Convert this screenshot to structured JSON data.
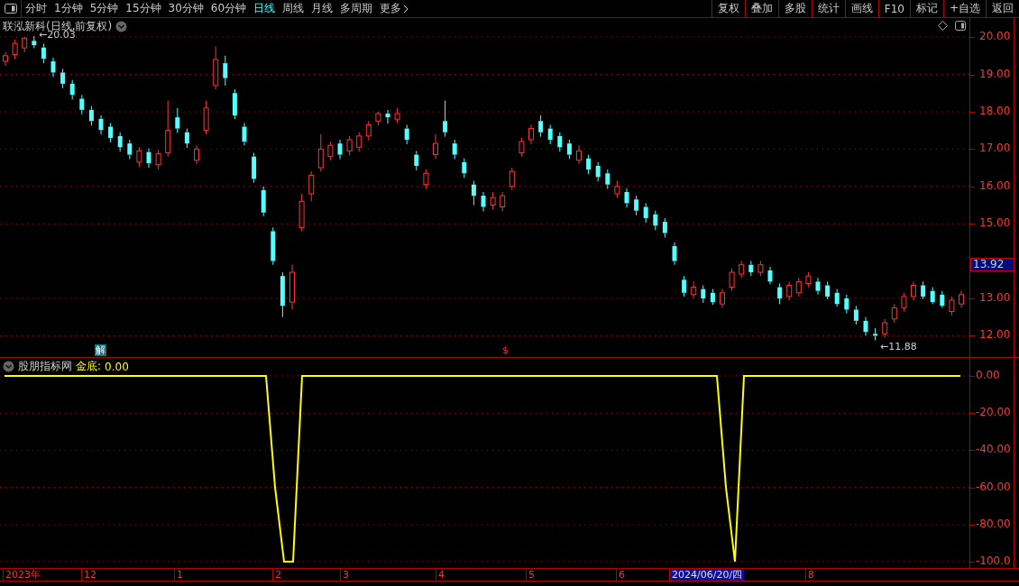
{
  "toolbar": {
    "periods": [
      {
        "label": "分时",
        "selected": false
      },
      {
        "label": "1分钟",
        "selected": false
      },
      {
        "label": "5分钟",
        "selected": false
      },
      {
        "label": "15分钟",
        "selected": false
      },
      {
        "label": "30分钟",
        "selected": false
      },
      {
        "label": "60分钟",
        "selected": false
      },
      {
        "label": "日线",
        "selected": true
      },
      {
        "label": "周线",
        "selected": false
      },
      {
        "label": "月线",
        "selected": false
      },
      {
        "label": "多周期",
        "selected": false
      }
    ],
    "more": "更多",
    "buttons": [
      "复权",
      "叠加",
      "多股",
      "统计",
      "画线",
      "F10",
      "标记",
      "+自选",
      "返回"
    ]
  },
  "chart": {
    "title": "联泓新科(日线,前复权)",
    "high_label": "←20.03",
    "low_label": "←11.88",
    "current_price": "13.92",
    "markers": [
      {
        "kind": "jie",
        "text": "解"
      },
      {
        "kind": "dollar",
        "text": "$"
      }
    ],
    "chart_data": {
      "type": "candlestick",
      "ylim": [
        11.43,
        20.51
      ],
      "grid": true,
      "yticks": [
        {
          "value": 20,
          "label": "20.00"
        },
        {
          "value": 19,
          "label": "19.00"
        },
        {
          "value": 18,
          "label": "18.00"
        },
        {
          "value": 17,
          "label": "17.00"
        },
        {
          "value": 16,
          "label": "16.00"
        },
        {
          "value": 15,
          "label": "15.00"
        },
        {
          "value": 13,
          "label": "13.00"
        },
        {
          "value": 12,
          "label": "12.00"
        }
      ],
      "ohlc": [
        [
          19.35,
          19.6,
          19.23,
          19.5
        ],
        [
          19.53,
          19.93,
          19.41,
          19.83
        ],
        [
          19.71,
          20.01,
          19.59,
          19.96
        ],
        [
          19.9,
          20.03,
          19.7,
          19.78
        ],
        [
          19.72,
          19.82,
          19.3,
          19.42
        ],
        [
          19.35,
          19.45,
          18.93,
          19.05
        ],
        [
          19.05,
          19.15,
          18.63,
          18.75
        ],
        [
          18.75,
          18.85,
          18.33,
          18.45
        ],
        [
          18.35,
          18.45,
          17.93,
          18.05
        ],
        [
          18.05,
          18.15,
          17.63,
          17.75
        ],
        [
          17.81,
          17.91,
          17.39,
          17.51
        ],
        [
          17.6,
          17.7,
          17.18,
          17.3
        ],
        [
          17.35,
          17.45,
          16.93,
          17.05
        ],
        [
          17.15,
          17.25,
          16.73,
          16.85
        ],
        [
          16.65,
          17.05,
          16.53,
          16.95
        ],
        [
          16.92,
          17.02,
          16.5,
          16.62
        ],
        [
          16.58,
          16.98,
          16.46,
          16.88
        ],
        [
          16.9,
          18.3,
          16.8,
          17.5
        ],
        [
          17.85,
          18.1,
          17.43,
          17.55
        ],
        [
          17.45,
          17.55,
          17.03,
          17.15
        ],
        [
          16.7,
          17.1,
          16.6,
          17.0
        ],
        [
          17.5,
          18.3,
          17.4,
          18.1
        ],
        [
          18.7,
          19.75,
          18.6,
          19.4
        ],
        [
          19.3,
          19.5,
          18.7,
          18.9
        ],
        [
          18.5,
          18.6,
          17.8,
          17.9
        ],
        [
          17.6,
          17.7,
          17.1,
          17.2
        ],
        [
          16.8,
          16.9,
          16.1,
          16.2
        ],
        [
          15.9,
          16.0,
          15.2,
          15.3
        ],
        [
          14.8,
          14.9,
          13.9,
          14.0
        ],
        [
          13.6,
          13.7,
          12.5,
          12.8
        ],
        [
          12.9,
          13.9,
          12.7,
          13.7
        ],
        [
          14.9,
          15.8,
          14.8,
          15.6
        ],
        [
          15.8,
          16.4,
          15.6,
          16.3
        ],
        [
          16.5,
          17.4,
          16.4,
          17.0
        ],
        [
          16.8,
          17.2,
          16.7,
          17.1
        ],
        [
          17.15,
          17.25,
          16.73,
          16.85
        ],
        [
          16.95,
          17.35,
          16.83,
          17.25
        ],
        [
          17.05,
          17.45,
          16.93,
          17.35
        ],
        [
          17.35,
          17.75,
          17.23,
          17.65
        ],
        [
          17.75,
          18.0,
          17.63,
          17.95
        ],
        [
          17.95,
          18.05,
          17.68,
          17.85
        ],
        [
          17.8,
          18.1,
          17.7,
          17.95
        ],
        [
          17.55,
          17.65,
          17.13,
          17.25
        ],
        [
          16.85,
          16.95,
          16.43,
          16.55
        ],
        [
          16.05,
          16.45,
          15.93,
          16.35
        ],
        [
          16.85,
          17.4,
          16.73,
          17.15
        ],
        [
          17.75,
          18.3,
          17.33,
          17.45
        ],
        [
          17.15,
          17.25,
          16.73,
          16.85
        ],
        [
          16.65,
          16.75,
          16.23,
          16.35
        ],
        [
          16.05,
          16.15,
          15.5,
          15.75
        ],
        [
          15.75,
          15.85,
          15.33,
          15.45
        ],
        [
          15.5,
          15.85,
          15.38,
          15.7
        ],
        [
          15.45,
          15.85,
          15.33,
          15.75
        ],
        [
          16.0,
          16.5,
          15.9,
          16.4
        ],
        [
          16.9,
          17.3,
          16.8,
          17.2
        ],
        [
          17.25,
          17.65,
          17.13,
          17.55
        ],
        [
          17.75,
          17.9,
          17.33,
          17.45
        ],
        [
          17.55,
          17.65,
          17.13,
          17.25
        ],
        [
          17.35,
          17.45,
          16.93,
          17.05
        ],
        [
          17.15,
          17.25,
          16.73,
          16.85
        ],
        [
          16.7,
          17.1,
          16.6,
          16.95
        ],
        [
          16.75,
          16.85,
          16.33,
          16.45
        ],
        [
          16.55,
          16.65,
          16.13,
          16.25
        ],
        [
          16.35,
          16.45,
          15.93,
          16.05
        ],
        [
          15.8,
          16.15,
          15.7,
          16.0
        ],
        [
          15.85,
          15.95,
          15.43,
          15.55
        ],
        [
          15.65,
          15.75,
          15.23,
          15.35
        ],
        [
          15.45,
          15.55,
          15.03,
          15.15
        ],
        [
          15.25,
          15.35,
          14.83,
          14.95
        ],
        [
          15.05,
          15.15,
          14.63,
          14.75
        ],
        [
          14.4,
          14.5,
          13.9,
          14.0
        ],
        [
          13.5,
          13.6,
          13.05,
          13.15
        ],
        [
          13.1,
          13.45,
          13.0,
          13.3
        ],
        [
          13.25,
          13.35,
          12.88,
          13.0
        ],
        [
          13.15,
          13.25,
          12.83,
          12.9
        ],
        [
          12.85,
          13.25,
          12.75,
          13.15
        ],
        [
          13.3,
          13.8,
          13.2,
          13.7
        ],
        [
          13.65,
          14.0,
          13.55,
          13.9
        ],
        [
          13.9,
          14.0,
          13.6,
          13.7
        ],
        [
          13.7,
          14.0,
          13.6,
          13.9
        ],
        [
          13.75,
          13.85,
          13.38,
          13.45
        ],
        [
          13.3,
          13.4,
          12.85,
          13.0
        ],
        [
          13.05,
          13.45,
          12.95,
          13.35
        ],
        [
          13.15,
          13.55,
          13.05,
          13.45
        ],
        [
          13.4,
          13.7,
          13.3,
          13.6
        ],
        [
          13.45,
          13.55,
          13.1,
          13.2
        ],
        [
          13.35,
          13.45,
          12.98,
          13.05
        ],
        [
          13.15,
          13.25,
          12.78,
          12.85
        ],
        [
          13.0,
          13.1,
          12.6,
          12.7
        ],
        [
          12.7,
          12.8,
          12.3,
          12.4
        ],
        [
          12.4,
          12.5,
          12.0,
          12.1
        ],
        [
          12.05,
          12.2,
          11.88,
          12.0
        ],
        [
          12.05,
          12.45,
          11.95,
          12.35
        ],
        [
          12.45,
          12.85,
          12.35,
          12.75
        ],
        [
          12.75,
          13.15,
          12.65,
          13.05
        ],
        [
          13.05,
          13.45,
          12.95,
          13.35
        ],
        [
          13.35,
          13.45,
          12.98,
          13.05
        ],
        [
          13.2,
          13.3,
          12.85,
          12.9
        ],
        [
          13.1,
          13.2,
          12.75,
          12.8
        ],
        [
          12.65,
          13.05,
          12.55,
          12.95
        ],
        [
          12.85,
          13.2,
          12.75,
          13.1
        ]
      ]
    }
  },
  "indicator": {
    "name": "股朋指标网",
    "separator": ":",
    "value": "0.00",
    "chart_data": {
      "type": "line",
      "grid": true,
      "ylim": [
        -100,
        0
      ],
      "yticks": [
        {
          "value": 0,
          "label": "0.00"
        },
        {
          "value": -20,
          "label": "-20.00"
        },
        {
          "value": -40,
          "label": "-40.00"
        },
        {
          "value": -60,
          "label": "-60.00"
        },
        {
          "value": -80,
          "label": "-80.00"
        },
        {
          "value": -100,
          "label": "-100.0"
        }
      ],
      "series": [
        {
          "name": "金底",
          "color": "#ffff00",
          "values": [
            0,
            0,
            0,
            0,
            0,
            0,
            0,
            0,
            0,
            0,
            0,
            0,
            0,
            0,
            0,
            0,
            0,
            0,
            0,
            0,
            0,
            0,
            0,
            0,
            0,
            0,
            0,
            0,
            0,
            0,
            -60,
            -100,
            -100,
            0,
            0,
            0,
            0,
            0,
            0,
            0,
            0,
            0,
            0,
            0,
            0,
            0,
            0,
            0,
            0,
            0,
            0,
            0,
            0,
            0,
            0,
            0,
            0,
            0,
            0,
            0,
            0,
            0,
            0,
            0,
            0,
            0,
            0,
            0,
            0,
            0,
            0,
            0,
            0,
            0,
            0,
            0,
            0,
            0,
            0,
            0,
            -60,
            -100,
            0,
            0,
            0,
            0,
            0,
            0,
            0,
            0,
            0,
            0,
            0,
            0,
            0,
            0,
            0,
            0,
            0,
            0,
            0,
            0,
            0,
            0,
            0,
            0,
            0
          ]
        }
      ]
    }
  },
  "date_axis": [
    {
      "label": "2023年",
      "selected": false
    },
    {
      "label": "12",
      "selected": false
    },
    {
      "label": "1",
      "selected": false
    },
    {
      "label": "2",
      "selected": false
    },
    {
      "label": "3",
      "selected": false
    },
    {
      "label": "4",
      "selected": false
    },
    {
      "label": "5",
      "selected": false
    },
    {
      "label": "6",
      "selected": false
    },
    {
      "label": "2024/06/20/四",
      "selected": true
    },
    {
      "label": "8",
      "selected": false
    }
  ]
}
